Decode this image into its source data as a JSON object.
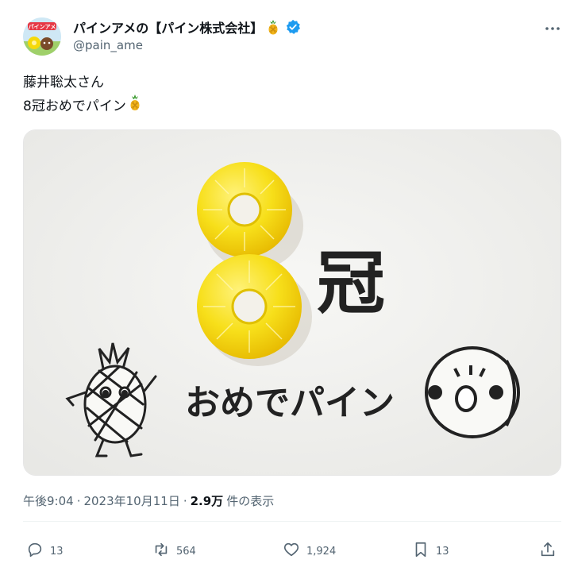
{
  "author": {
    "display_name": "パインアメの【パイン株式会社】",
    "handle": "@pain_ame",
    "avatar_text": "パインアメ",
    "verified": true
  },
  "tweet": {
    "line1": "藤井聡太さん",
    "line2": "8冠おめでパイン"
  },
  "image": {
    "kanji": "冠",
    "caption": "おめでパイン"
  },
  "meta": {
    "time": "午後9:04",
    "separator1": "·",
    "date": "2023年10月11日",
    "separator2": "·",
    "views_count": "2.9万",
    "views_label": "件の表示"
  },
  "actions": {
    "replies": "13",
    "retweets": "564",
    "likes": "1,924",
    "bookmarks": "13"
  },
  "colors": {
    "verified_blue": "#1d9bf0",
    "text_primary": "#0f1419",
    "text_secondary": "#536471",
    "candy_yellow": "#f5d90a"
  }
}
